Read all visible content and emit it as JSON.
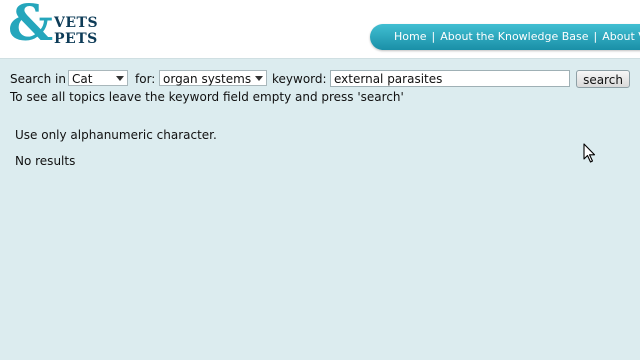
{
  "logo": {
    "line1": "VETS",
    "line2": "PETS",
    "mark": "&"
  },
  "nav": {
    "items": [
      "Home",
      "About the Knowledge Base",
      "About V"
    ],
    "separator": "|"
  },
  "search": {
    "search_in_label": "Search in",
    "species_value": "Cat",
    "for_label": "for:",
    "category_value": "organ systems",
    "keyword_label": "keyword:",
    "keyword_value": "external parasites",
    "button_label": "search",
    "hint": "To see all topics leave the keyword field empty and press 'search'"
  },
  "results": {
    "validation_message": "Use only alphanumeric character.",
    "status": "No results"
  },
  "icons": {
    "cursor": "mouse-pointer-icon",
    "dropdown": "chevron-down-icon"
  }
}
